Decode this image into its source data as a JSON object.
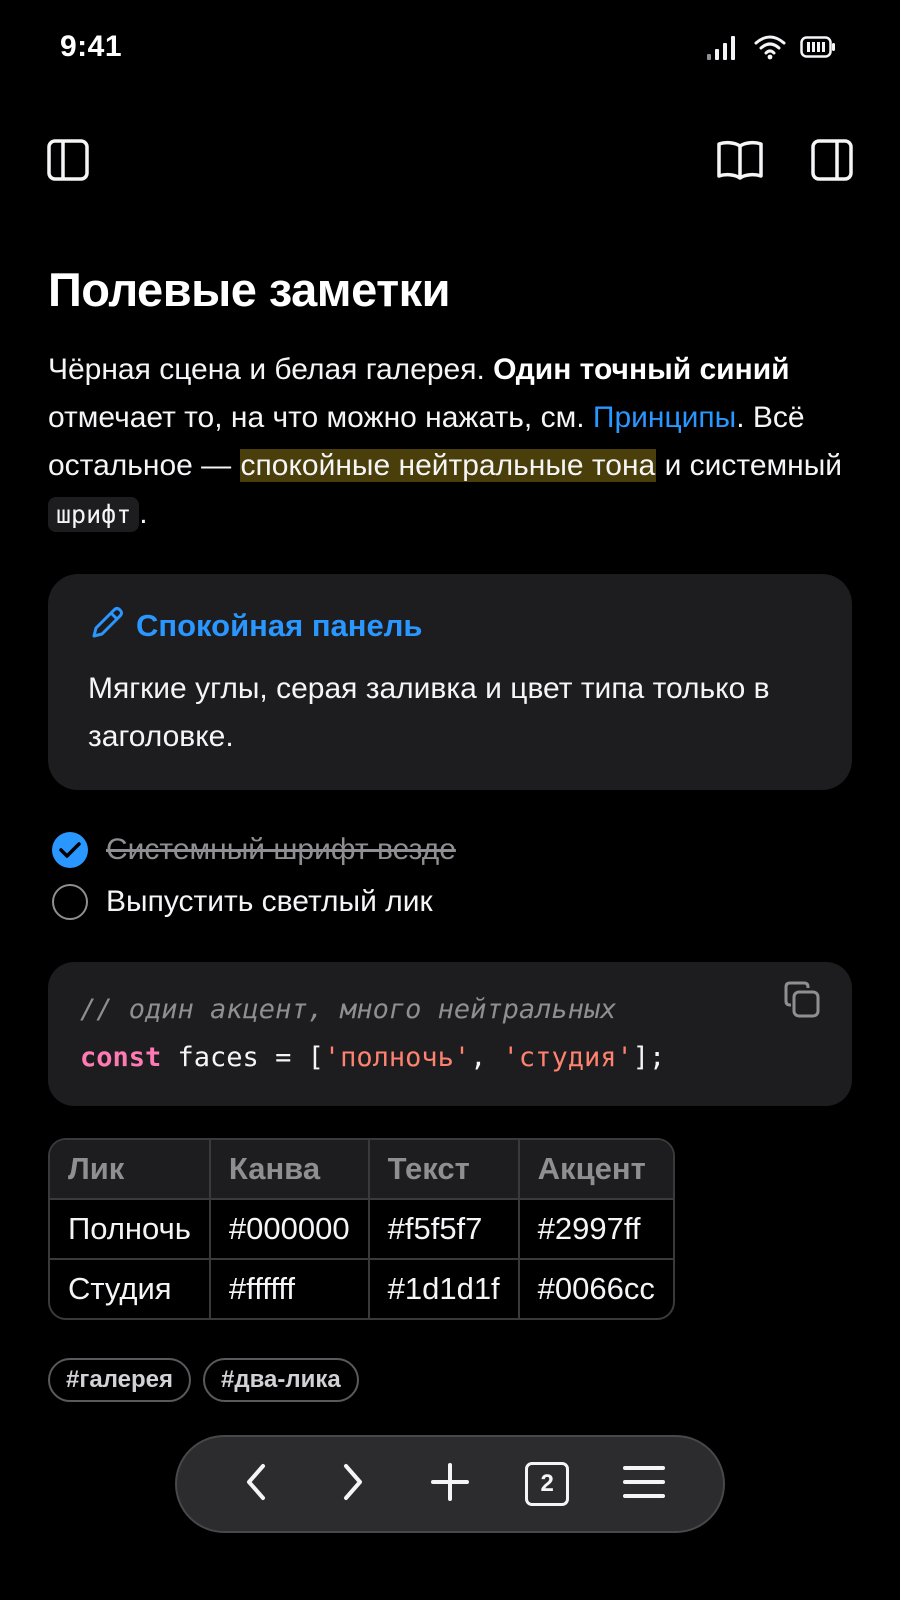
{
  "status_bar": {
    "time": "9:41",
    "icons": [
      "cellular-signal-icon",
      "wifi-icon",
      "battery-icon"
    ]
  },
  "toolbar": {
    "left_icon": "sidebar-left-icon",
    "right_icons": [
      "reader-book-icon",
      "sidebar-right-icon"
    ]
  },
  "note": {
    "title": "Полевые заметки",
    "intro": {
      "part1": "Чёрная сцена и белая галерея. ",
      "bold": "Один точный синий",
      "part2": " отмечает то, на что можно нажать, см. ",
      "link": "Принципы",
      "part3": ". Всё остальное — ",
      "highlight": "спокойные нейтральные тона",
      "part4": " и системный ",
      "code": "шрифт",
      "part5": "."
    },
    "callout": {
      "icon": "pencil-icon",
      "title": "Спокойная панель",
      "body": "Мягкие углы, серая заливка и цвет типа только в заголовке."
    },
    "tasks": [
      {
        "label": "Системный шрифт везде",
        "done": true
      },
      {
        "label": "Выпустить светлый лик",
        "done": false
      }
    ],
    "code_block": {
      "comment": "// один акцент, много нейтральных",
      "keyword": "const",
      "ident": " faces = [",
      "str1": "'полночь'",
      "sep": ", ",
      "str2": "'студия'",
      "end": "];"
    },
    "table": {
      "headers": [
        "Лик",
        "Канва",
        "Текст",
        "Акцент"
      ],
      "rows": [
        [
          "Полночь",
          "#000000",
          "#f5f5f7",
          "#2997ff"
        ],
        [
          "Студия",
          "#ffffff",
          "#1d1d1f",
          "#0066cc"
        ]
      ]
    },
    "tags": [
      "#галерея",
      "#два-лика"
    ]
  },
  "bottom_bar": {
    "buttons": [
      "back-icon",
      "forward-icon",
      "new-tab-icon",
      "tabs-icon",
      "menu-icon"
    ],
    "tabs_count": "2"
  },
  "colors": {
    "background": "#000000",
    "text": "#f5f5f7",
    "accent": "#2997ff",
    "panel": "#1d1d1f",
    "muted": "#8e8e93"
  }
}
